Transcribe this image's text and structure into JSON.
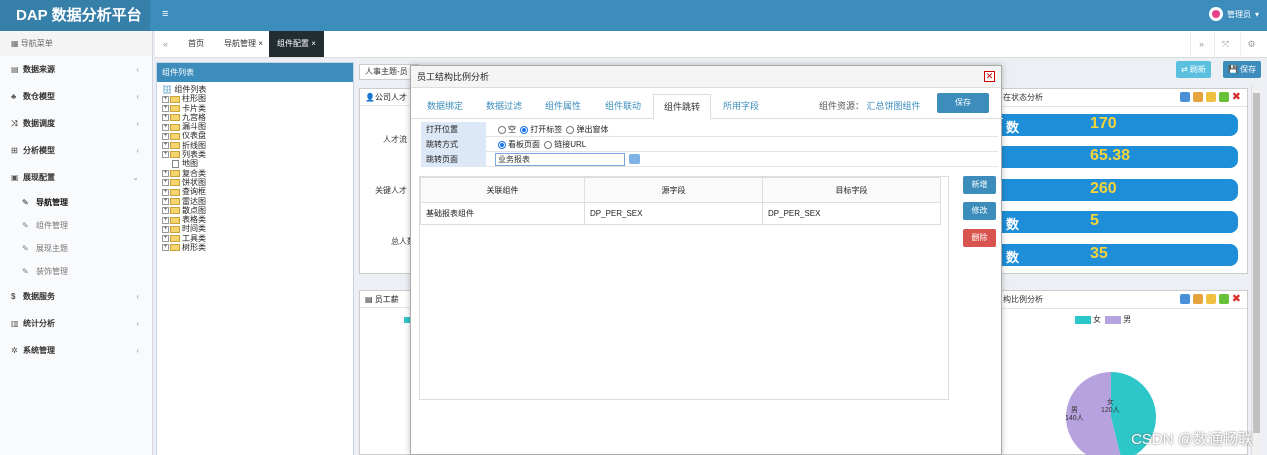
{
  "app": {
    "brand": "DAP 数据分析平台",
    "user": "管理员"
  },
  "sidebar": {
    "header": "导航菜单",
    "items": [
      {
        "label": "数据来源",
        "icon": "database-icon",
        "glyph": "▤"
      },
      {
        "label": "数仓模型",
        "icon": "cubes-icon",
        "glyph": "♣"
      },
      {
        "label": "数据调度",
        "icon": "shuffle-icon",
        "glyph": "⤨"
      },
      {
        "label": "分析模型",
        "icon": "sitemap-icon",
        "glyph": "⊞"
      },
      {
        "label": "展现配置",
        "icon": "display-icon",
        "glyph": "▣"
      }
    ],
    "subitems": [
      "导航管理",
      "组件管理",
      "展现主题",
      "装饰管理"
    ],
    "items2": [
      {
        "label": "数据服务",
        "icon": "dollar-icon",
        "glyph": "$"
      },
      {
        "label": "统计分析",
        "icon": "barchart-icon",
        "glyph": "▥"
      },
      {
        "label": "系统管理",
        "icon": "gear-icon",
        "glyph": "✲"
      }
    ]
  },
  "tabs": {
    "home": "首页",
    "nav": "导航管理 ×",
    "active": "组件配置 ×"
  },
  "left_panel": {
    "title": "组件列表",
    "root": "组件列表",
    "nodes": [
      "柱形图",
      "卡片类",
      "九宫格",
      "漏斗图",
      "仪表盘",
      "折线图",
      "列表类",
      "地图",
      "复合类",
      "饼状图",
      "查询框",
      "雷达图",
      "散点图",
      "表格类",
      "时间类",
      "工具类",
      "树形类"
    ]
  },
  "bg": {
    "page_tab": "人事主题-员",
    "panel1_title": "公司人才",
    "label_talent": "人才流",
    "label_key": "关键人才",
    "label_total": "总人数",
    "panel2_title": "员工薪",
    "refresh": "⇄ 刷新",
    "save": "💾 保存",
    "r1_title": "在状态分析",
    "r2_title": "构比例分析",
    "kpis": [
      {
        "k": "数",
        "v": "170"
      },
      {
        "k": "",
        "v": "65.38"
      },
      {
        "k": "",
        "v": "260"
      },
      {
        "k": "数",
        "v": "5"
      },
      {
        "k": "数",
        "v": "35"
      }
    ],
    "legend": [
      "女",
      "男"
    ],
    "pie": {
      "male_label": "男",
      "male_count": "140人",
      "female_label": "女",
      "female_count": "120人"
    },
    "colors": {
      "female": "#2ec7c9",
      "male": "#b6a2de"
    }
  },
  "chart_data": {
    "type": "pie",
    "categories": [
      "女",
      "男"
    ],
    "values": [
      120,
      140
    ],
    "legend": "top"
  },
  "modal": {
    "title": "员工结构比例分析",
    "tabs": [
      "数据绑定",
      "数据过滤",
      "组件属性",
      "组件联动",
      "组件跳转",
      "所用字段"
    ],
    "resource_label": "组件资源：",
    "resource_value": "汇总饼图组件",
    "save": "保存",
    "form": {
      "open_label": "打开位置",
      "open_options": [
        "空",
        "打开标签",
        "弹出窗体"
      ],
      "jump_label": "跳转方式",
      "jump_options": [
        "看板页面",
        "链接URL"
      ],
      "page_label": "跳转页面",
      "page_value": "业务报表"
    },
    "grid": {
      "headers": [
        "关联组件",
        "源字段",
        "目标字段"
      ],
      "rows": [
        [
          "基础报表组件",
          "DP_PER_SEX",
          "DP_PER_SEX"
        ]
      ]
    },
    "buttons": {
      "add": "新增",
      "edit": "修改",
      "del": "删除"
    }
  },
  "watermark": "CSDN @数通畅联"
}
